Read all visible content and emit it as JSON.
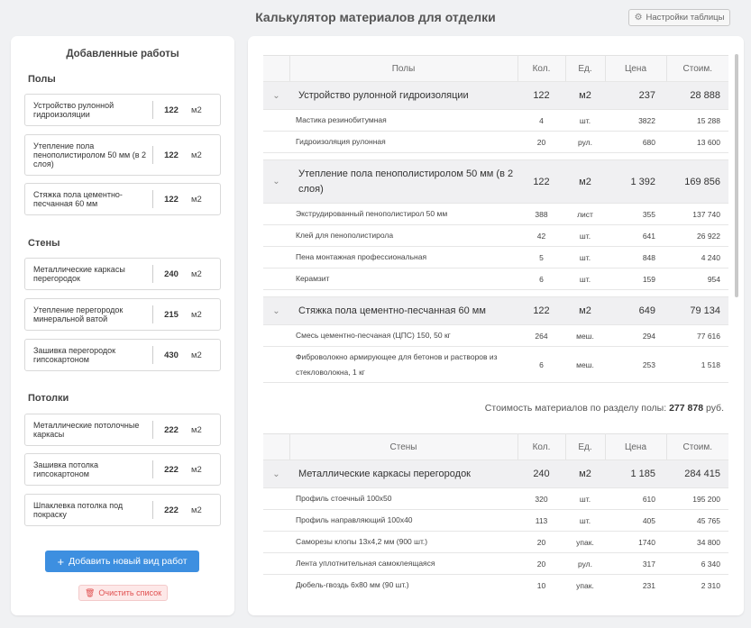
{
  "header": {
    "title": "Калькулятор материалов для отделки",
    "settings_label": "Настройки таблицы",
    "settings_icon": "gear-icon"
  },
  "sidebar": {
    "title": "Добавленные работы",
    "sections": [
      {
        "label": "Полы",
        "items": [
          {
            "name": "Устройство рулонной гидроизоляции",
            "qty": "122",
            "unit": "м2"
          },
          {
            "name": "Утепление пола пенополистиролом 50 мм (в 2 слоя)",
            "qty": "122",
            "unit": "м2"
          },
          {
            "name": "Стяжка пола цементно-песчанная 60 мм",
            "qty": "122",
            "unit": "м2"
          }
        ]
      },
      {
        "label": "Стены",
        "items": [
          {
            "name": "Металлические каркасы перегородок",
            "qty": "240",
            "unit": "м2"
          },
          {
            "name": "Утепление перегородок минеральной ватой",
            "qty": "215",
            "unit": "м2"
          },
          {
            "name": "Зашивка перегородок гипсокартоном",
            "qty": "430",
            "unit": "м2"
          }
        ]
      },
      {
        "label": "Потолки",
        "items": [
          {
            "name": "Металлические потолочные каркасы",
            "qty": "222",
            "unit": "м2"
          },
          {
            "name": "Зашивка потолка гипсокартоном",
            "qty": "222",
            "unit": "м2"
          },
          {
            "name": "Шпаклевка потолка под покраску",
            "qty": "222",
            "unit": "м2"
          }
        ]
      }
    ],
    "add_button": "Добавить новый вид работ",
    "clear_button": "Очистить список"
  },
  "tables": {
    "columns": {
      "qty": "Кол.",
      "unit": "Ед.",
      "price": "Цена",
      "cost": "Стоим."
    },
    "floors": {
      "header": "Полы",
      "works": [
        {
          "name": "Устройство рулонной гидроизоляции",
          "qty": "122",
          "unit": "м2",
          "price": "237",
          "cost": "28 888",
          "materials": [
            {
              "name": "Мастика резинобитумная",
              "qty": "4",
              "unit": "шт.",
              "price": "3822",
              "cost": "15 288"
            },
            {
              "name": "Гидроизоляция рулонная",
              "qty": "20",
              "unit": "рул.",
              "price": "680",
              "cost": "13 600"
            }
          ]
        },
        {
          "name": "Утепление пола пенополистиролом 50 мм (в 2 слоя)",
          "qty": "122",
          "unit": "м2",
          "price": "1 392",
          "cost": "169 856",
          "materials": [
            {
              "name": "Экструдированный пенополистирол 50 мм",
              "qty": "388",
              "unit": "лист",
              "price": "355",
              "cost": "137 740"
            },
            {
              "name": "Клей для пенополистирола",
              "qty": "42",
              "unit": "шт.",
              "price": "641",
              "cost": "26 922"
            },
            {
              "name": "Пена монтажная профессиональная",
              "qty": "5",
              "unit": "шт.",
              "price": "848",
              "cost": "4 240"
            },
            {
              "name": "Керамзит",
              "qty": "6",
              "unit": "шт.",
              "price": "159",
              "cost": "954"
            }
          ]
        },
        {
          "name": "Стяжка пола цементно-песчанная 60 мм",
          "qty": "122",
          "unit": "м2",
          "price": "649",
          "cost": "79 134",
          "materials": [
            {
              "name": "Смесь цементно-песчаная (ЦПС) 150, 50 кг",
              "qty": "264",
              "unit": "меш.",
              "price": "294",
              "cost": "77 616"
            },
            {
              "name": "Фиброволокно армирующее для бетонов и растворов из стекловолокна, 1 кг",
              "qty": "6",
              "unit": "меш.",
              "price": "253",
              "cost": "1 518"
            }
          ]
        }
      ],
      "total_label": "Стоимость материалов по разделу полы:",
      "total_value": "277 878",
      "total_currency": "руб."
    },
    "walls": {
      "header": "Стены",
      "works": [
        {
          "name": "Металлические каркасы перегородок",
          "qty": "240",
          "unit": "м2",
          "price": "1 185",
          "cost": "284 415",
          "materials": [
            {
              "name": "Профиль стоечный 100х50",
              "qty": "320",
              "unit": "шт.",
              "price": "610",
              "cost": "195 200"
            },
            {
              "name": "Профиль направляющий 100х40",
              "qty": "113",
              "unit": "шт.",
              "price": "405",
              "cost": "45 765"
            },
            {
              "name": "Саморезы клопы 13х4,2 мм (900 шт.)",
              "qty": "20",
              "unit": "упак.",
              "price": "1740",
              "cost": "34 800"
            },
            {
              "name": "Лента уплотнительная самоклеящаяся",
              "qty": "20",
              "unit": "рул.",
              "price": "317",
              "cost": "6 340"
            },
            {
              "name": "Дюбель-гвоздь 6х80 мм (90 шт.)",
              "qty": "10",
              "unit": "упак.",
              "price": "231",
              "cost": "2 310"
            }
          ]
        }
      ]
    }
  }
}
